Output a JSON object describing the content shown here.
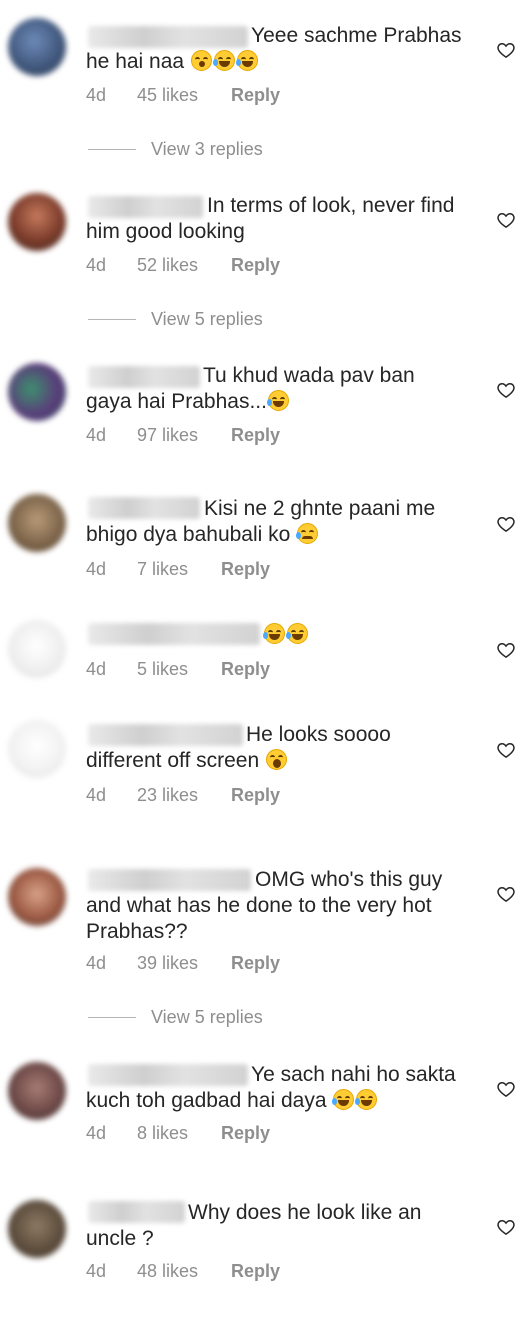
{
  "comments": [
    {
      "text": "Yeee sachme Prabhas\nhe hai naa",
      "emojis": "😮😂😂",
      "age": "4d",
      "likes": "45 likes",
      "reply": "Reply",
      "view_replies": "View 3 replies"
    },
    {
      "text": "In terms of look, never find\nhim good looking",
      "emojis": "",
      "age": "4d",
      "likes": "52 likes",
      "reply": "Reply",
      "view_replies": "View 5 replies"
    },
    {
      "text": "Tu khud wada pav ban\ngaya hai Prabhas...",
      "emojis": "😂",
      "age": "4d",
      "likes": "97 likes",
      "reply": "Reply"
    },
    {
      "text": "Kisi ne 2 ghnte paani me\nbhigo dya bahubali ko",
      "emojis": "😢",
      "age": "4d",
      "likes": "7 likes",
      "reply": "Reply"
    },
    {
      "text": "",
      "emojis": "😂😂",
      "age": "4d",
      "likes": "5 likes",
      "reply": "Reply"
    },
    {
      "text": "He looks soooo\ndifferent off screen",
      "emojis": "😱",
      "age": "4d",
      "likes": "23 likes",
      "reply": "Reply"
    },
    {
      "text": "OMG who's this guy\nand what has he done to the very hot\nPrabhas??",
      "emojis": "",
      "age": "4d",
      "likes": "39 likes",
      "reply": "Reply",
      "view_replies": "View 5 replies"
    },
    {
      "text": "Ye sach nahi ho sakta\nkuch toh gadbad hai daya",
      "emojis": "😂😂",
      "age": "4d",
      "likes": "8 likes",
      "reply": "Reply"
    },
    {
      "text": "Why does he look like an\nuncle ?",
      "emojis": "",
      "age": "4d",
      "likes": "48 likes",
      "reply": "Reply"
    }
  ],
  "icons": {
    "heart": "heart-outline-icon"
  },
  "colors": {
    "meta": "#8e8e8e",
    "text": "#262626"
  }
}
